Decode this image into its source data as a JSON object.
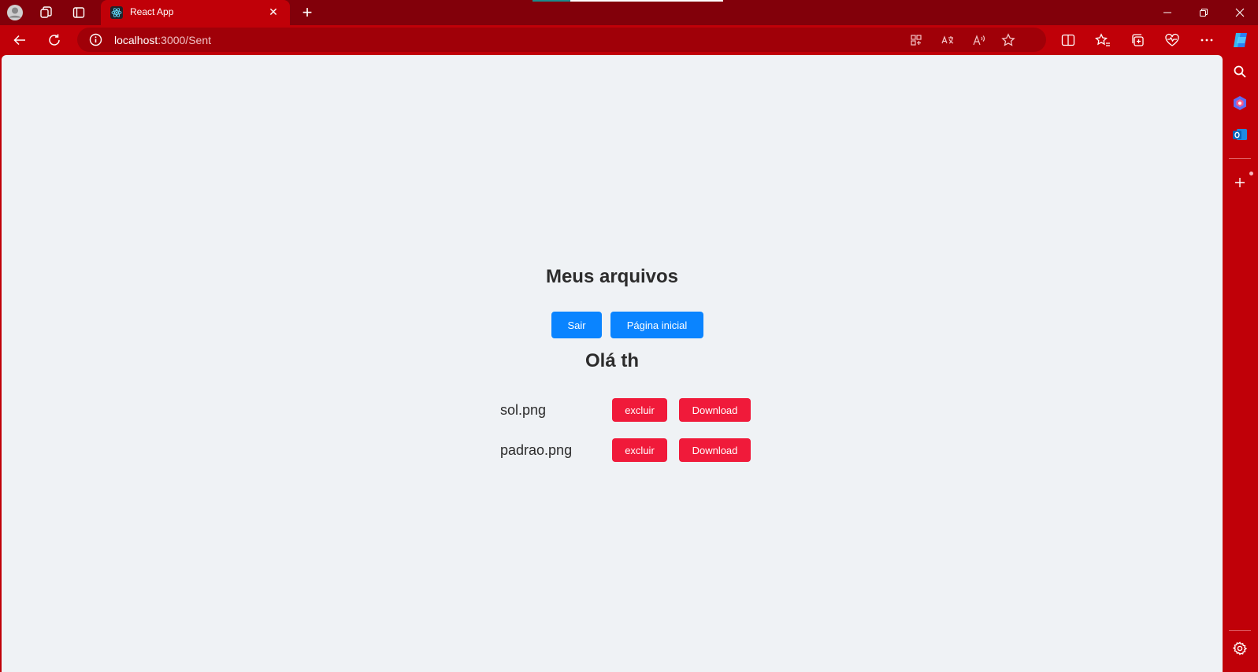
{
  "browser": {
    "tab_title": "React App",
    "url_host": "localhost",
    "url_path": ":3000/Sent",
    "accent_color": "#c00008"
  },
  "icons": {
    "profile": "profile-icon",
    "workspaces": "workspaces-icon",
    "tab_actions": "tab-actions-icon",
    "back": "back-arrow-icon",
    "refresh": "refresh-icon",
    "info": "site-info-icon",
    "app_grid": "app-available-icon",
    "translate": "translate-icon",
    "read_aloud": "read-aloud-icon",
    "favorite": "favorite-star-icon",
    "split": "split-screen-icon",
    "favorites": "favorites-icon",
    "collections": "collections-icon",
    "health": "browser-essentials-icon",
    "more": "more-icon",
    "copilot": "copilot-icon"
  },
  "sidebar": {
    "search": "search-icon",
    "copilot": "copilot-sidebar-icon",
    "outlook": "outlook-icon",
    "add": "add-icon",
    "settings": "settings-icon"
  },
  "page": {
    "title": "Meus arquivos",
    "buttons": {
      "logout": "Sair",
      "home": "Página inicial"
    },
    "greeting": "Olá th",
    "files": [
      {
        "name": "sol.png",
        "delete_label": "excluir",
        "download_label": "Download"
      },
      {
        "name": "padrao.png",
        "delete_label": "excluir",
        "download_label": "Download"
      }
    ],
    "colors": {
      "primary_button": "#0a84ff",
      "danger_button": "#f01a3a",
      "background": "#eff2f5"
    }
  }
}
